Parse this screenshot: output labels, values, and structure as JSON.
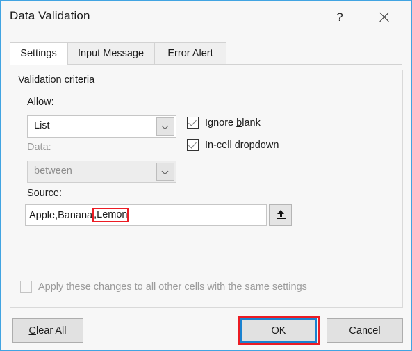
{
  "window": {
    "title": "Data Validation",
    "help_icon": "question-mark-icon",
    "close_icon": "close-icon",
    "border_color": "#41a4e2"
  },
  "tabs": [
    {
      "label": "Settings",
      "active": true
    },
    {
      "label": "Input Message",
      "active": false
    },
    {
      "label": "Error Alert",
      "active": false
    }
  ],
  "group": {
    "legend": "Validation criteria"
  },
  "allow": {
    "label_acc": "A",
    "label_rest": "llow:",
    "value": "List",
    "arrow_icon": "chevron-down-icon",
    "enabled": true
  },
  "data": {
    "label": "Data:",
    "value": "between",
    "arrow_icon": "chevron-down-icon",
    "enabled": false
  },
  "source": {
    "label_acc": "S",
    "label_rest": "ource:",
    "value": "Apple,Banana,Lemon",
    "value_prefix": "Apple,Banana",
    "value_highlighted": ",Lemon",
    "highlight_color": "#ec1c24",
    "range_button_icon": "range-select-up-arrow-icon"
  },
  "checkboxes": {
    "ignore_blank": {
      "label_pre": "Ignore ",
      "label_acc": "b",
      "label_post": "lank",
      "checked": true,
      "enabled": true
    },
    "in_cell_dropdown": {
      "label_acc": "I",
      "label_post": "n-cell dropdown",
      "checked": true,
      "enabled": true
    },
    "apply_all": {
      "label": "Apply these changes to all other cells with the same settings",
      "checked": false,
      "enabled": false
    }
  },
  "buttons": {
    "clear_all_acc": "C",
    "clear_all_rest": "lear All",
    "ok": "OK",
    "cancel": "Cancel",
    "ok_focus_color": "#1a82d0",
    "ok_annotation_color": "#ec1c24"
  }
}
